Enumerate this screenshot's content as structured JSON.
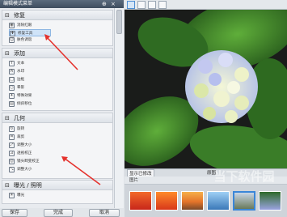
{
  "panel": {
    "title": "编辑模式菜单",
    "pin_glyph": "⊕",
    "close_glyph": "×",
    "sections": [
      {
        "label": "修复",
        "toggle": "⊟",
        "items": [
          "消除红眼",
          "修复工具",
          "肤色调谐"
        ],
        "selected_index": 1
      },
      {
        "label": "添加",
        "toggle": "⊟",
        "items": [
          "文本",
          "水印",
          "边框",
          "晕影",
          "特殊效果",
          "倾斜移位"
        ]
      },
      {
        "label": "几何",
        "toggle": "⊟",
        "items": [
          "旋转",
          "裁剪",
          "调整大小",
          "透视校正",
          "镜头畸变校正",
          "调整大小"
        ]
      },
      {
        "label": "曝光 / 照明",
        "toggle": "⊟",
        "items": [
          "曝光"
        ]
      }
    ]
  },
  "buttons": {
    "save": "保存",
    "done": "完成",
    "cancel": "取消"
  },
  "bottom_tabs": {
    "left": "显示已修改",
    "right": "原图"
  },
  "filmbar": {
    "label": "图片"
  },
  "watermark": "当下软件园",
  "colors": {
    "accent": "#3b86d8",
    "panel_header": "#4a5a6c"
  }
}
